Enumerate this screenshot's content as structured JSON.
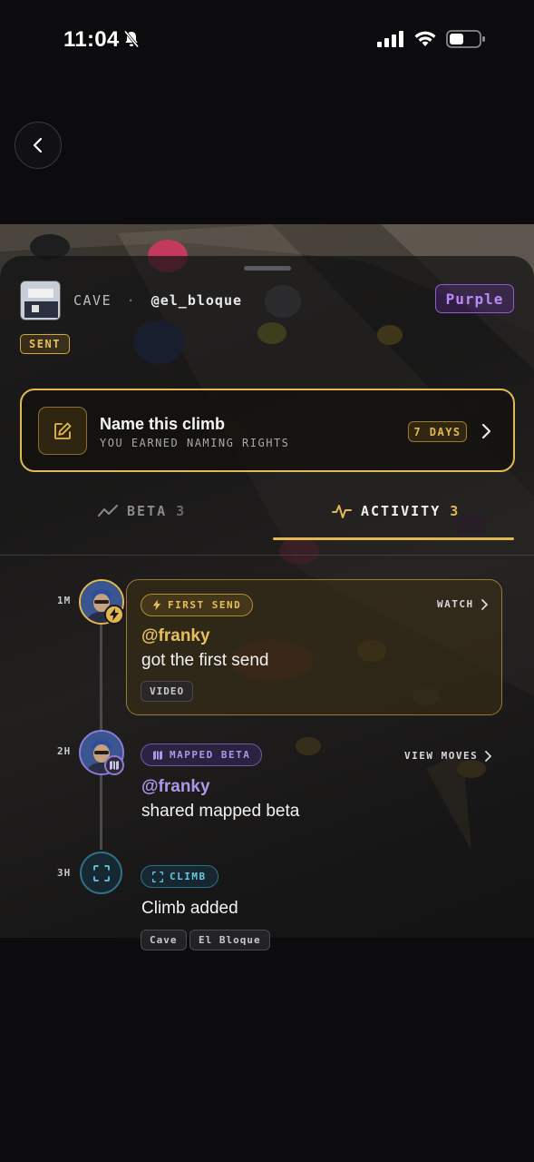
{
  "status_bar": {
    "time": "11:04"
  },
  "header": {
    "gym_label": "CAVE",
    "separator": "·",
    "user_handle": "@el_bloque",
    "grade": "Purple",
    "sent_label": "SENT"
  },
  "naming_card": {
    "title": "Name this climb",
    "subtitle": "YOU EARNED NAMING RIGHTS",
    "days_badge": "7 DAYS"
  },
  "tabs": [
    {
      "label": "BETA",
      "count": "3"
    },
    {
      "label": "ACTIVITY",
      "count": "3"
    }
  ],
  "timeline": [
    {
      "time": "1M",
      "type_label": "FIRST SEND",
      "action": "WATCH",
      "user": "@franky",
      "text": "got the first send",
      "tags": [
        "VIDEO"
      ]
    },
    {
      "time": "2H",
      "type_label": "MAPPED BETA",
      "action": "VIEW MOVES",
      "user": "@franky",
      "text": "shared mapped beta",
      "tags": []
    },
    {
      "time": "3H",
      "type_label": "CLIMB",
      "action": "",
      "user": "",
      "text": "Climb added",
      "tags": [
        "Cave",
        "El Bloque"
      ]
    }
  ],
  "colors": {
    "gold": "#e3b851",
    "purple": "#a998e8",
    "cyan": "#6cc4e0",
    "grade_purple": "#b98af5"
  }
}
